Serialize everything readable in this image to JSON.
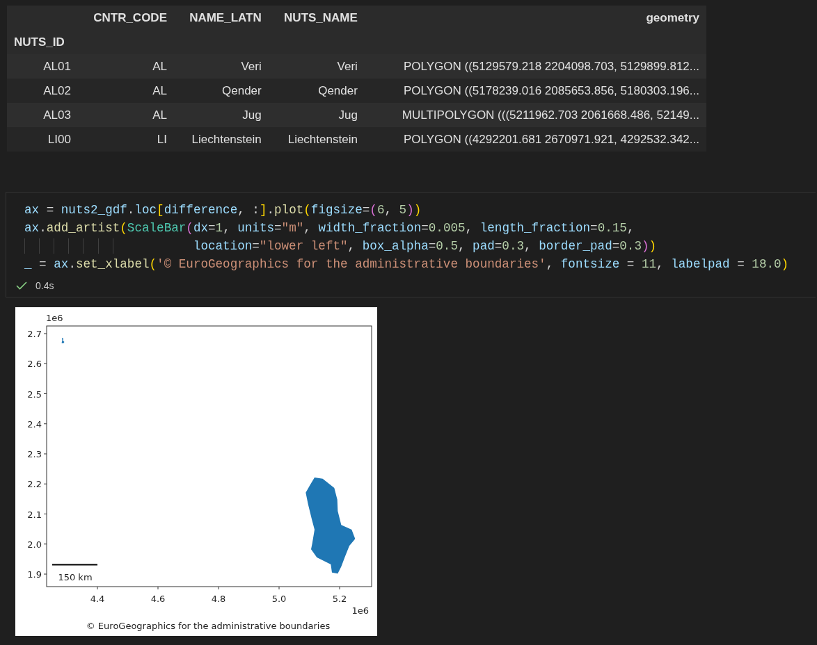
{
  "table": {
    "columns": [
      "CNTR_CODE",
      "NAME_LATN",
      "NUTS_NAME",
      "geometry"
    ],
    "index_name": "NUTS_ID",
    "rows": [
      {
        "index": "AL01",
        "cells": [
          "AL",
          "Veri",
          "Veri",
          "POLYGON ((5129579.218 2204098.703, 5129899.812..."
        ]
      },
      {
        "index": "AL02",
        "cells": [
          "AL",
          "Qender",
          "Qender",
          "POLYGON ((5178239.016 2085653.856, 5180303.196..."
        ]
      },
      {
        "index": "AL03",
        "cells": [
          "AL",
          "Jug",
          "Jug",
          "MULTIPOLYGON (((5211962.703 2061668.486, 52149..."
        ]
      },
      {
        "index": "LI00",
        "cells": [
          "LI",
          "Liechtenstein",
          "Liechtenstein",
          "POLYGON ((4292201.681 2670971.921, 4292532.342..."
        ]
      }
    ]
  },
  "code_cell": {
    "lines": [
      {
        "kind": "code",
        "tokens": [
          {
            "text": "ax",
            "kind": "var"
          },
          {
            "text": " = ",
            "kind": "op"
          },
          {
            "text": "nuts2_gdf",
            "kind": "var"
          },
          {
            "text": ".",
            "kind": "op"
          },
          {
            "text": "loc",
            "kind": "var"
          },
          {
            "text": "[",
            "kind": "br1"
          },
          {
            "text": "difference",
            "kind": "var"
          },
          {
            "text": ", :",
            "kind": "op"
          },
          {
            "text": "]",
            "kind": "br1"
          },
          {
            "text": ".",
            "kind": "op"
          },
          {
            "text": "plot",
            "kind": "fn"
          },
          {
            "text": "(",
            "kind": "br1"
          },
          {
            "text": "figsize",
            "kind": "var"
          },
          {
            "text": "=",
            "kind": "op"
          },
          {
            "text": "(",
            "kind": "br2"
          },
          {
            "text": "6",
            "kind": "num"
          },
          {
            "text": ", ",
            "kind": "op"
          },
          {
            "text": "5",
            "kind": "num"
          },
          {
            "text": ")",
            "kind": "br2"
          },
          {
            "text": ")",
            "kind": "br1"
          }
        ]
      },
      {
        "kind": "code",
        "tokens": [
          {
            "text": "ax",
            "kind": "var"
          },
          {
            "text": ".",
            "kind": "op"
          },
          {
            "text": "add_artist",
            "kind": "fn"
          },
          {
            "text": "(",
            "kind": "br1"
          },
          {
            "text": "ScaleBar",
            "kind": "cls"
          },
          {
            "text": "(",
            "kind": "br2"
          },
          {
            "text": "dx",
            "kind": "var"
          },
          {
            "text": "=",
            "kind": "op"
          },
          {
            "text": "1",
            "kind": "num"
          },
          {
            "text": ", ",
            "kind": "op"
          },
          {
            "text": "units",
            "kind": "var"
          },
          {
            "text": "=",
            "kind": "op"
          },
          {
            "text": "\"m\"",
            "kind": "str"
          },
          {
            "text": ", ",
            "kind": "op"
          },
          {
            "text": "width_fraction",
            "kind": "var"
          },
          {
            "text": "=",
            "kind": "op"
          },
          {
            "text": "0.005",
            "kind": "num"
          },
          {
            "text": ", ",
            "kind": "op"
          },
          {
            "text": "length_fraction",
            "kind": "var"
          },
          {
            "text": "=",
            "kind": "op"
          },
          {
            "text": "0.15",
            "kind": "num"
          },
          {
            "text": ",",
            "kind": "op"
          }
        ]
      },
      {
        "kind": "continuation",
        "tokens": [
          {
            "text": "location",
            "kind": "var"
          },
          {
            "text": "=",
            "kind": "op"
          },
          {
            "text": "\"lower left\"",
            "kind": "str"
          },
          {
            "text": ", ",
            "kind": "op"
          },
          {
            "text": "box_alpha",
            "kind": "var"
          },
          {
            "text": "=",
            "kind": "op"
          },
          {
            "text": "0.5",
            "kind": "num"
          },
          {
            "text": ", ",
            "kind": "op"
          },
          {
            "text": "pad",
            "kind": "var"
          },
          {
            "text": "=",
            "kind": "op"
          },
          {
            "text": "0.3",
            "kind": "num"
          },
          {
            "text": ", ",
            "kind": "op"
          },
          {
            "text": "border_pad",
            "kind": "var"
          },
          {
            "text": "=",
            "kind": "op"
          },
          {
            "text": "0.3",
            "kind": "num"
          },
          {
            "text": ")",
            "kind": "br2"
          },
          {
            "text": ")",
            "kind": "br1"
          }
        ]
      },
      {
        "kind": "code",
        "tokens": [
          {
            "text": "_",
            "kind": "var"
          },
          {
            "text": " = ",
            "kind": "op"
          },
          {
            "text": "ax",
            "kind": "var"
          },
          {
            "text": ".",
            "kind": "op"
          },
          {
            "text": "set_xlabel",
            "kind": "fn"
          },
          {
            "text": "(",
            "kind": "br1"
          },
          {
            "text": "'© EuroGeographics for the administrative boundaries'",
            "kind": "str"
          },
          {
            "text": ", ",
            "kind": "op"
          },
          {
            "text": "fontsize",
            "kind": "var"
          },
          {
            "text": " = ",
            "kind": "op"
          },
          {
            "text": "11",
            "kind": "num"
          },
          {
            "text": ", ",
            "kind": "op"
          },
          {
            "text": "labelpad",
            "kind": "var"
          },
          {
            "text": " = ",
            "kind": "op"
          },
          {
            "text": "18.0",
            "kind": "num"
          },
          {
            "text": ")",
            "kind": "br1"
          }
        ]
      }
    ],
    "status": {
      "kind": "success",
      "duration": "0.4s"
    }
  },
  "plot": {
    "y_offset": "1e6",
    "x_offset": "1e6",
    "y_ticks": [
      "2.7",
      "2.6",
      "2.5",
      "2.4",
      "2.3",
      "2.2",
      "2.1",
      "2.0",
      "1.9"
    ],
    "x_ticks": [
      "4.4",
      "4.6",
      "4.8",
      "5.0",
      "5.2"
    ],
    "scale_label": "150 km",
    "xlabel": "© EuroGeographics for the administrative boundaries"
  }
}
